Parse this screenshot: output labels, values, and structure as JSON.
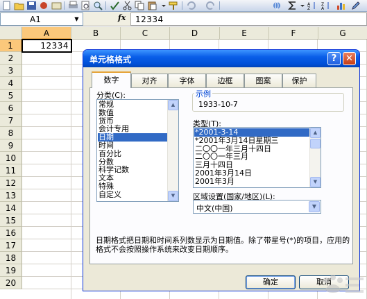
{
  "formula_bar": {
    "name_box": "A1",
    "fx_label": "fx",
    "content": "12334"
  },
  "sheet": {
    "columns": [
      "A",
      "B",
      "C",
      "D",
      "E",
      "F",
      "G"
    ],
    "rows": [
      "1",
      "2",
      "3",
      "4",
      "5",
      "6",
      "7",
      "8",
      "9",
      "10",
      "11",
      "12",
      "13",
      "14",
      "15",
      "16",
      "17",
      "18",
      "19",
      "20"
    ],
    "active_cell_value": "12334"
  },
  "dialog": {
    "title": "单元格格式",
    "help_label": "?",
    "close_label": "✕",
    "tabs": [
      "数字",
      "对齐",
      "字体",
      "边框",
      "图案",
      "保护"
    ],
    "category_label": "分类(C):",
    "categories": [
      "常规",
      "数值",
      "货币",
      "会计专用",
      "日期",
      "时间",
      "百分比",
      "分数",
      "科学记数",
      "文本",
      "特殊",
      "自定义"
    ],
    "sample_label": "示例",
    "sample_value": "1933-10-7",
    "type_label": "类型(T):",
    "types": [
      "*2001-3-14",
      "*2001年3月14日星期三",
      "二〇〇一年三月十四日",
      "二〇〇一年三月",
      "三月十四日",
      "2001年3月14日",
      "2001年3月"
    ],
    "locale_label": "区域设置(国家/地区)(L):",
    "locale_value": "中文(中国)",
    "description": "日期格式把日期和时间系列数显示为日期值。除了带星号(*)的项目，应用的格式不会按照操作系统来改变日期顺序。",
    "ok_label": "确定",
    "cancel_label": "取消"
  },
  "colors": {
    "titlebar": "#0a5ee8",
    "selection": "#316ac5",
    "active_header": "#fbc87b"
  }
}
